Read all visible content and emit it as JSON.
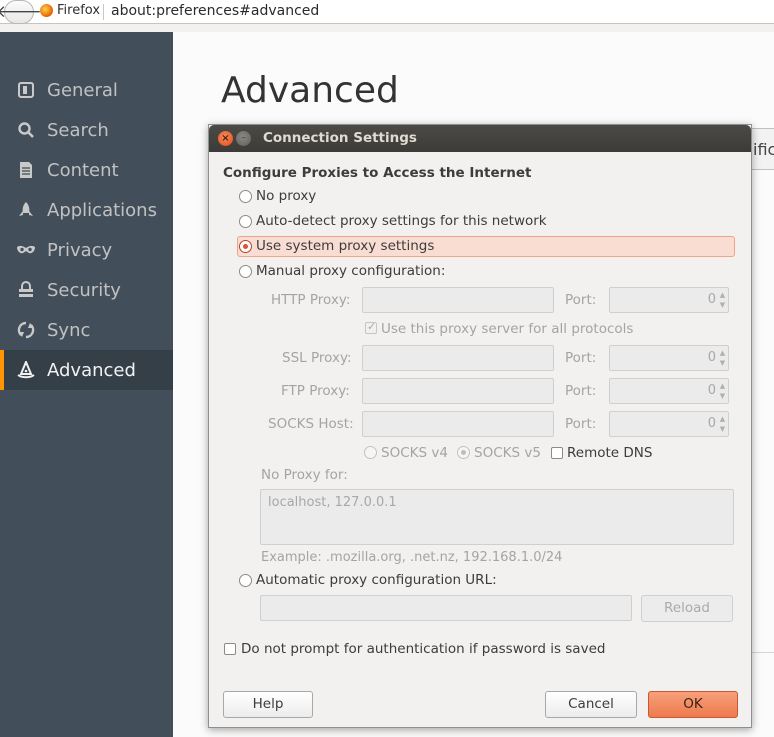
{
  "browser": {
    "identity_label": "Firefox",
    "url": "about:preferences#advanced"
  },
  "sidebar": {
    "items": [
      {
        "label": "General",
        "icon": "general-icon"
      },
      {
        "label": "Search",
        "icon": "search-icon"
      },
      {
        "label": "Content",
        "icon": "document-icon"
      },
      {
        "label": "Applications",
        "icon": "rocket-icon"
      },
      {
        "label": "Privacy",
        "icon": "mask-icon"
      },
      {
        "label": "Security",
        "icon": "lock-icon"
      },
      {
        "label": "Sync",
        "icon": "sync-icon"
      },
      {
        "label": "Advanced",
        "icon": "wizard-hat-icon",
        "selected": true
      }
    ]
  },
  "main": {
    "title": "Advanced",
    "partial_tab_text": "ific"
  },
  "dialog": {
    "title": "Connection Settings",
    "heading": "Configure Proxies to Access the Internet",
    "options": {
      "no_proxy": "No proxy",
      "auto_detect": "Auto-detect proxy settings for this network",
      "use_system": "Use system proxy settings",
      "manual": "Manual proxy configuration:",
      "auto_url": "Automatic proxy configuration URL:"
    },
    "selected_option": "use_system",
    "manual": {
      "http_label": "HTTP Proxy:",
      "ssl_label": "SSL Proxy:",
      "ftp_label": "FTP Proxy:",
      "socks_label": "SOCKS Host:",
      "port_label": "Port:",
      "http_port": "0",
      "ssl_port": "0",
      "ftp_port": "0",
      "socks_port": "0",
      "share_label": "Use this proxy server for all protocols",
      "socks_v4": "SOCKS v4",
      "socks_v5": "SOCKS v5",
      "remote_dns": "Remote DNS"
    },
    "no_proxy_for_label": "No Proxy for:",
    "no_proxy_for_value": "localhost, 127.0.0.1",
    "example": "Example: .mozilla.org, .net.nz, 192.168.1.0/24",
    "reload_label": "Reload",
    "auth_label": "Do not prompt for authentication if password is saved",
    "buttons": {
      "help": "Help",
      "cancel": "Cancel",
      "ok": "OK"
    }
  },
  "colors": {
    "sidebar_bg": "#424f5a",
    "sidebar_selected_bg": "#343f48",
    "accent": "#ff9500",
    "ok_button": "#ee7a4d",
    "selected_highlight": "#f9ddd3"
  }
}
